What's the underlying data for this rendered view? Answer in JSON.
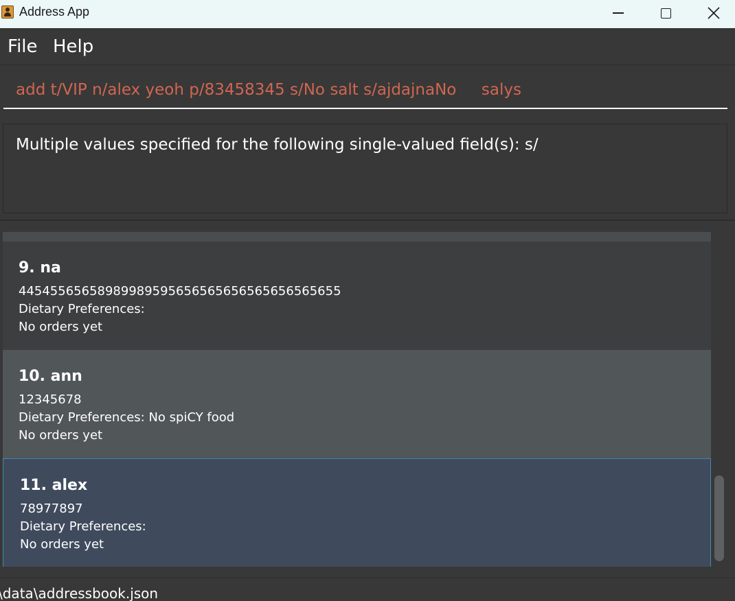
{
  "window": {
    "title": "Address App",
    "icon": "app-contact-icon"
  },
  "menu": {
    "file": "File",
    "help": "Help"
  },
  "command": {
    "value": "add t/VIP n/alex yeoh p/83458345 s/No salt s/ajdajnaNo     salys",
    "text_color": "#d06651"
  },
  "result": {
    "message": "Multiple values specified for the following single-valued field(s): s/"
  },
  "persons": [
    {
      "name": "9. na",
      "phone": "44545565658989989595656565656565656565655",
      "diet": "Dietary Preferences:",
      "orders": "No orders yet"
    },
    {
      "name": "10. ann",
      "phone": "12345678",
      "diet": "Dietary Preferences: No spiCY food",
      "orders": "No orders yet"
    },
    {
      "name": "11. alex",
      "phone": "78977897",
      "diet": "Dietary Preferences:",
      "orders": "No orders yet"
    }
  ],
  "status": {
    "path": "\\data\\addressbook.json"
  },
  "colors": {
    "background": "#383838",
    "card_alt": "#515658",
    "card_selected": "#3f4b5d",
    "selection_border": "#3c8ab3"
  }
}
